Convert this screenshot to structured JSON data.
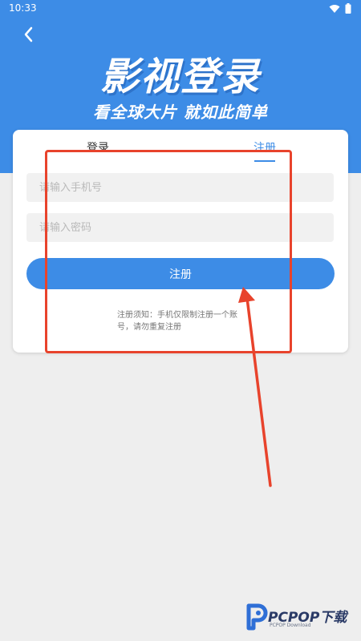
{
  "status_bar": {
    "time": "10:33"
  },
  "hero": {
    "title": "影视登录",
    "subtitle": "看全球大片  就如此简单"
  },
  "tabs": [
    {
      "label": "登录",
      "active": false
    },
    {
      "label": "注册",
      "active": true
    }
  ],
  "form": {
    "phone_placeholder": "请输入手机号",
    "password_placeholder": "请输入密码",
    "submit_label": "注册",
    "notice": "注册须知：手机仅限制注册一个账号，请勿重复注册"
  },
  "watermark": {
    "brand": "PCPOP下载",
    "sub": "PCPOP Download"
  },
  "colors": {
    "accent": "#3d8ce6",
    "annotation": "#e8432c",
    "background": "#eeeeee"
  },
  "icons": [
    "back-arrow-icon",
    "wifi-icon",
    "battery-icon",
    "watermark-logo-icon"
  ]
}
